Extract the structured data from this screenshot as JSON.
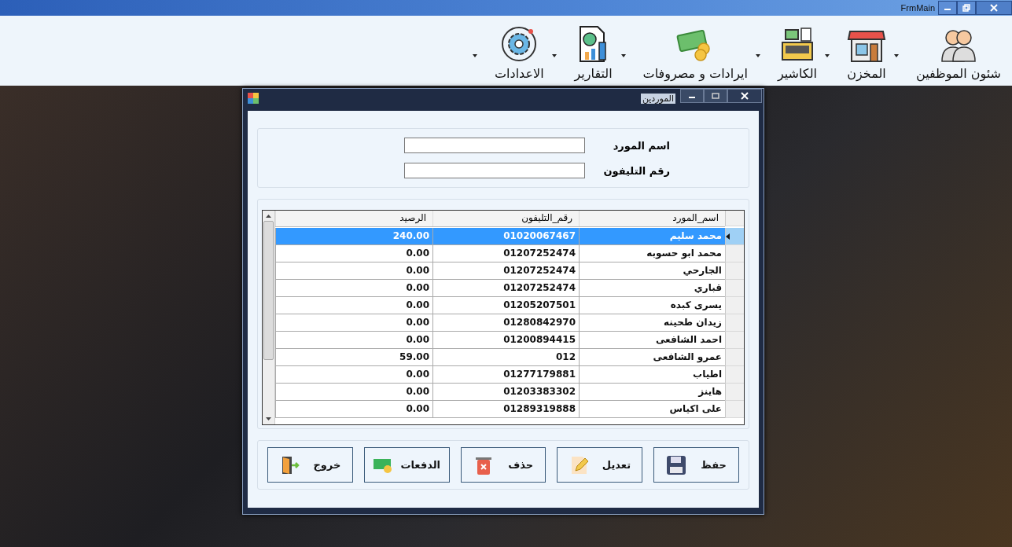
{
  "main_window": {
    "title": "FrmMain"
  },
  "menu": [
    {
      "label": "شئون الموظفين",
      "kind": "staff"
    },
    {
      "label": "المخزن",
      "kind": "store"
    },
    {
      "label": "الكاشير",
      "kind": "cashier"
    },
    {
      "label": "ايرادات و مصروفات",
      "kind": "money"
    },
    {
      "label": "التقارير",
      "kind": "reports"
    },
    {
      "label": "الاعدادات",
      "kind": "settings"
    }
  ],
  "dialog": {
    "title": "الموردين",
    "fields": [
      {
        "label": "اسم المورد"
      },
      {
        "label": "رقم التليفون"
      }
    ],
    "table": {
      "columns": [
        "اسم_المورد",
        "رقم_التليفون",
        "الرصيد"
      ],
      "rows": [
        {
          "cells": [
            "محمد سليم",
            "01020067467",
            "240.00"
          ],
          "selected": true
        },
        {
          "cells": [
            "محمد ابو حسوبه",
            "01207252474",
            "0.00"
          ],
          "selected": false
        },
        {
          "cells": [
            "الجارحي",
            "01207252474",
            "0.00"
          ],
          "selected": false
        },
        {
          "cells": [
            "قباري",
            "01207252474",
            "0.00"
          ],
          "selected": false
        },
        {
          "cells": [
            "يسرى كبده",
            "01205207501",
            "0.00"
          ],
          "selected": false
        },
        {
          "cells": [
            "زيدان طحينه",
            "01280842970",
            "0.00"
          ],
          "selected": false
        },
        {
          "cells": [
            "احمد الشافعى",
            "01200894415",
            "0.00"
          ],
          "selected": false
        },
        {
          "cells": [
            "عمرو الشافعى",
            "012",
            "59.00"
          ],
          "selected": false
        },
        {
          "cells": [
            "اطياب",
            "01277179881",
            "0.00"
          ],
          "selected": false
        },
        {
          "cells": [
            "هاينز",
            "01203383302",
            "0.00"
          ],
          "selected": false
        },
        {
          "cells": [
            "على اكياس",
            "01289319888",
            "0.00"
          ],
          "selected": false
        }
      ]
    },
    "buttons": [
      {
        "label": "حفظ",
        "kind": "save"
      },
      {
        "label": "تعديل",
        "kind": "edit"
      },
      {
        "label": "حذف",
        "kind": "delete"
      },
      {
        "label": "الدفعات",
        "kind": "payments"
      },
      {
        "label": "خروج",
        "kind": "exit"
      }
    ]
  }
}
